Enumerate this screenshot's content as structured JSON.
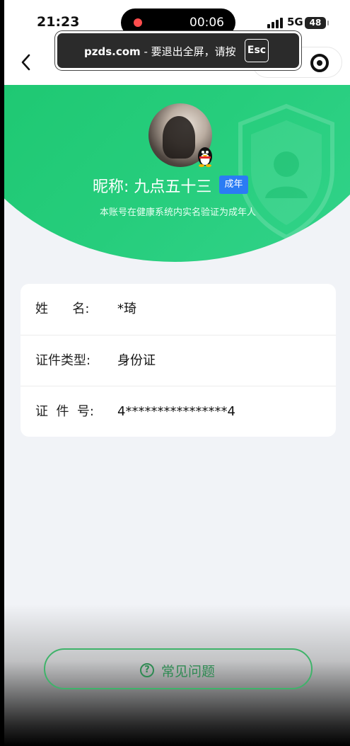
{
  "status_bar": {
    "time": "21:23",
    "recording_timer": "00:06",
    "network": "5G",
    "battery": "48"
  },
  "esc_banner": {
    "site": "pzds.com",
    "message": " - 要退出全屏，请按",
    "key": "Esc"
  },
  "nav": {
    "back_icon": "chevron-left-icon",
    "capsule_icon": "target-icon"
  },
  "profile": {
    "nickname": "昵称: 九点五十三",
    "badge": "成年",
    "description": "本账号在健康系统内实名验证为成年人",
    "avatar_badge_icon": "qq-penguin-icon"
  },
  "info_rows": [
    {
      "label": "姓      名:",
      "value": "*琦"
    },
    {
      "label": "证件类型:",
      "value": "身份证"
    },
    {
      "label": "证  件  号:",
      "value": "4****************4"
    }
  ],
  "faq": {
    "label": "常见问题",
    "icon": "question-circle-icon"
  },
  "colors": {
    "hero_green": "#1fc874",
    "badge_blue": "#2b7cf4",
    "faq_green": "#2e8a52"
  }
}
